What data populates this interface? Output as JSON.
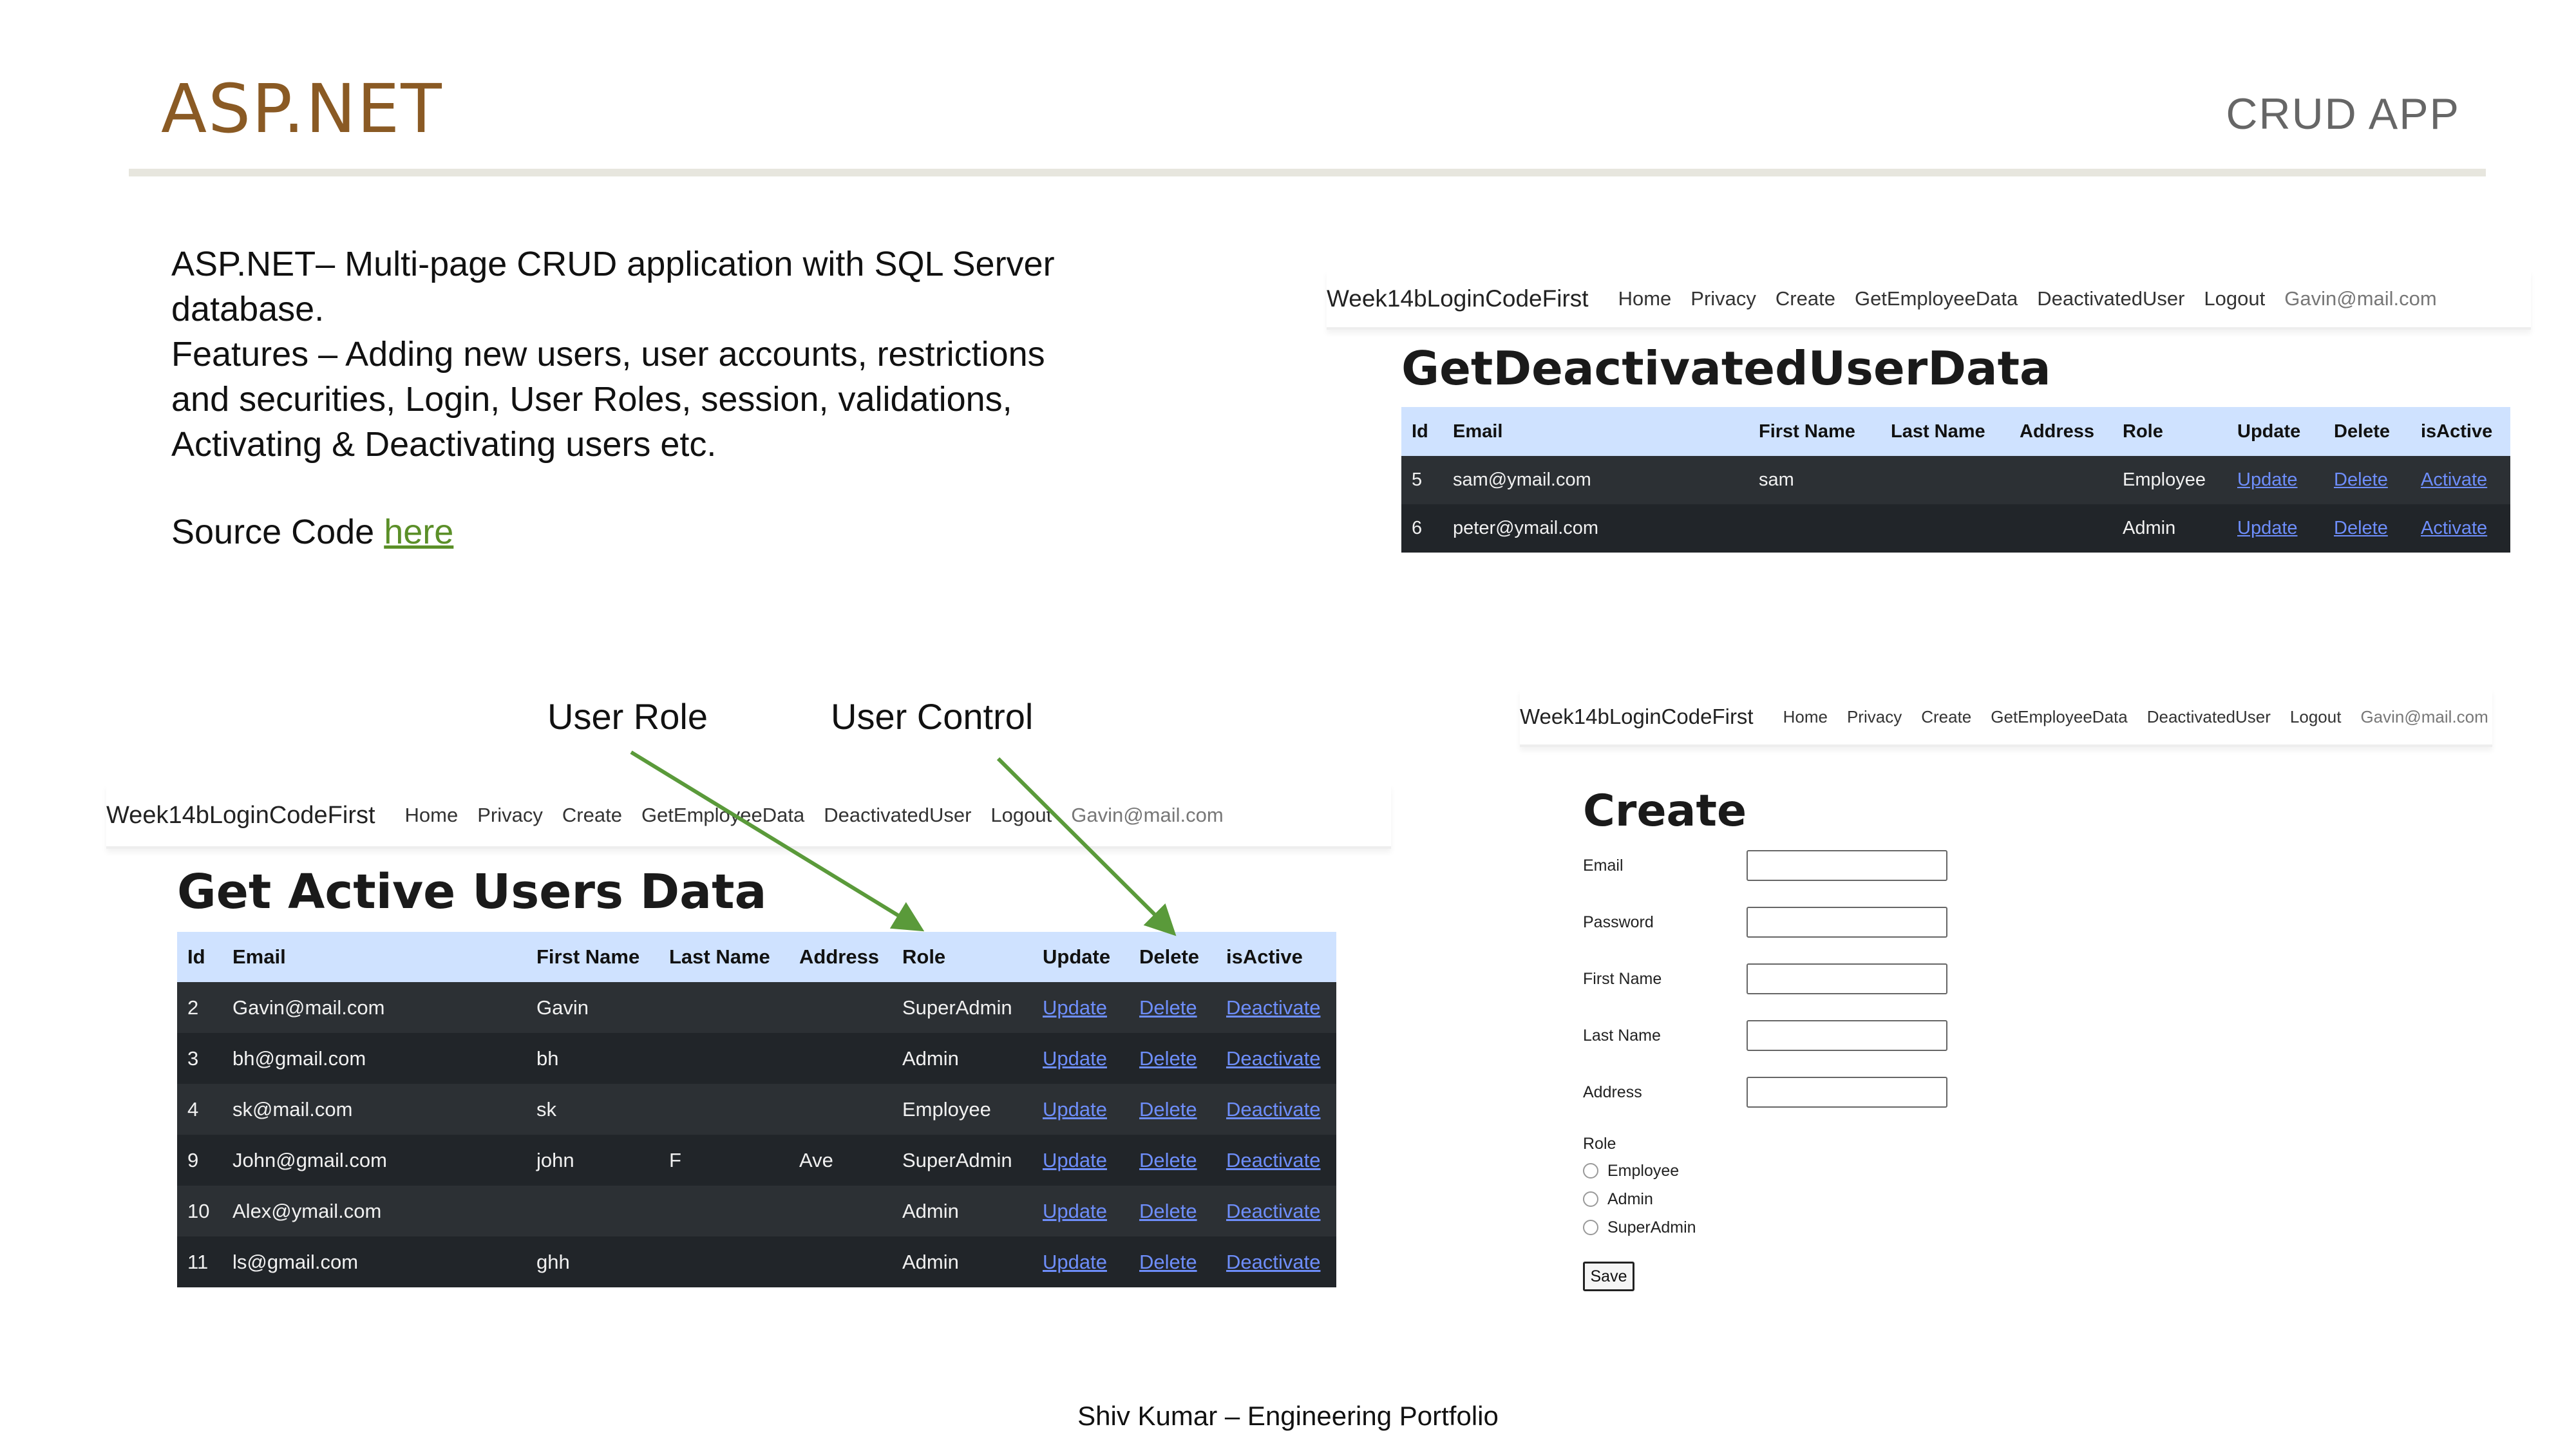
{
  "slide": {
    "title": "ASP.NET",
    "subtitle": "CRUD APP",
    "description_lines": [
      "ASP.NET– Multi-page CRUD application with SQL Server",
      "database.",
      "Features – Adding new users, user accounts, restrictions",
      "and securities, Login, User Roles, session, validations,",
      "Activating & Deactivating users etc."
    ],
    "source_prefix": "Source Code",
    "source_link": "here",
    "label_user_role": "User Role",
    "label_user_control": "User Control",
    "footer": "Shiv Kumar – Engineering Portfolio"
  },
  "navbar": {
    "brand": "Week14bLoginCodeFirst",
    "links": [
      "Home",
      "Privacy",
      "Create",
      "GetEmployeeData",
      "DeactivatedUser",
      "Logout"
    ],
    "user": "Gavin@mail.com"
  },
  "deactivated": {
    "heading": "GetDeactivatedUserData",
    "columns": [
      "Id",
      "Email",
      "First Name",
      "Last Name",
      "Address",
      "Role",
      "Update",
      "Delete",
      "isActive"
    ],
    "rows": [
      {
        "id": "5",
        "email": "sam@ymail.com",
        "first": "sam",
        "last": "",
        "address": "",
        "role": "Employee",
        "update": "Update",
        "delete": "Delete",
        "action": "Activate"
      },
      {
        "id": "6",
        "email": "peter@ymail.com",
        "first": "",
        "last": "",
        "address": "",
        "role": "Admin",
        "update": "Update",
        "delete": "Delete",
        "action": "Activate"
      }
    ]
  },
  "active": {
    "heading": "Get Active Users Data",
    "columns": [
      "Id",
      "Email",
      "First Name",
      "Last Name",
      "Address",
      "Role",
      "Update",
      "Delete",
      "isActive"
    ],
    "rows": [
      {
        "id": "2",
        "email": "Gavin@mail.com",
        "first": "Gavin",
        "last": "",
        "address": "",
        "role": "SuperAdmin",
        "update": "Update",
        "delete": "Delete",
        "action": "Deactivate"
      },
      {
        "id": "3",
        "email": "bh@gmail.com",
        "first": "bh",
        "last": "",
        "address": "",
        "role": "Admin",
        "update": "Update",
        "delete": "Delete",
        "action": "Deactivate"
      },
      {
        "id": "4",
        "email": "sk@mail.com",
        "first": "sk",
        "last": "",
        "address": "",
        "role": "Employee",
        "update": "Update",
        "delete": "Delete",
        "action": "Deactivate"
      },
      {
        "id": "9",
        "email": "John@gmail.com",
        "first": "john",
        "last": "F",
        "address": "Ave",
        "role": "SuperAdmin",
        "update": "Update",
        "delete": "Delete",
        "action": "Deactivate"
      },
      {
        "id": "10",
        "email": "Alex@ymail.com",
        "first": "",
        "last": "",
        "address": "",
        "role": "Admin",
        "update": "Update",
        "delete": "Delete",
        "action": "Deactivate"
      },
      {
        "id": "11",
        "email": "ls@gmail.com",
        "first": "ghh",
        "last": "",
        "address": "",
        "role": "Admin",
        "update": "Update",
        "delete": "Delete",
        "action": "Deactivate"
      }
    ]
  },
  "create_form": {
    "heading": "Create",
    "fields": [
      {
        "label": "Email",
        "value": ""
      },
      {
        "label": "Password",
        "value": ""
      },
      {
        "label": "First Name",
        "value": ""
      },
      {
        "label": "Last Name",
        "value": ""
      },
      {
        "label": "Address",
        "value": ""
      }
    ],
    "role_label": "Role",
    "role_options": [
      "Employee",
      "Admin",
      "SuperAdmin"
    ],
    "save_label": "Save"
  },
  "colors": {
    "title": "#8a5a24",
    "link": "#5b8f28",
    "arrow": "#5a9a3a",
    "table_header": "#cfe2ff",
    "table_dark": "#212529"
  }
}
